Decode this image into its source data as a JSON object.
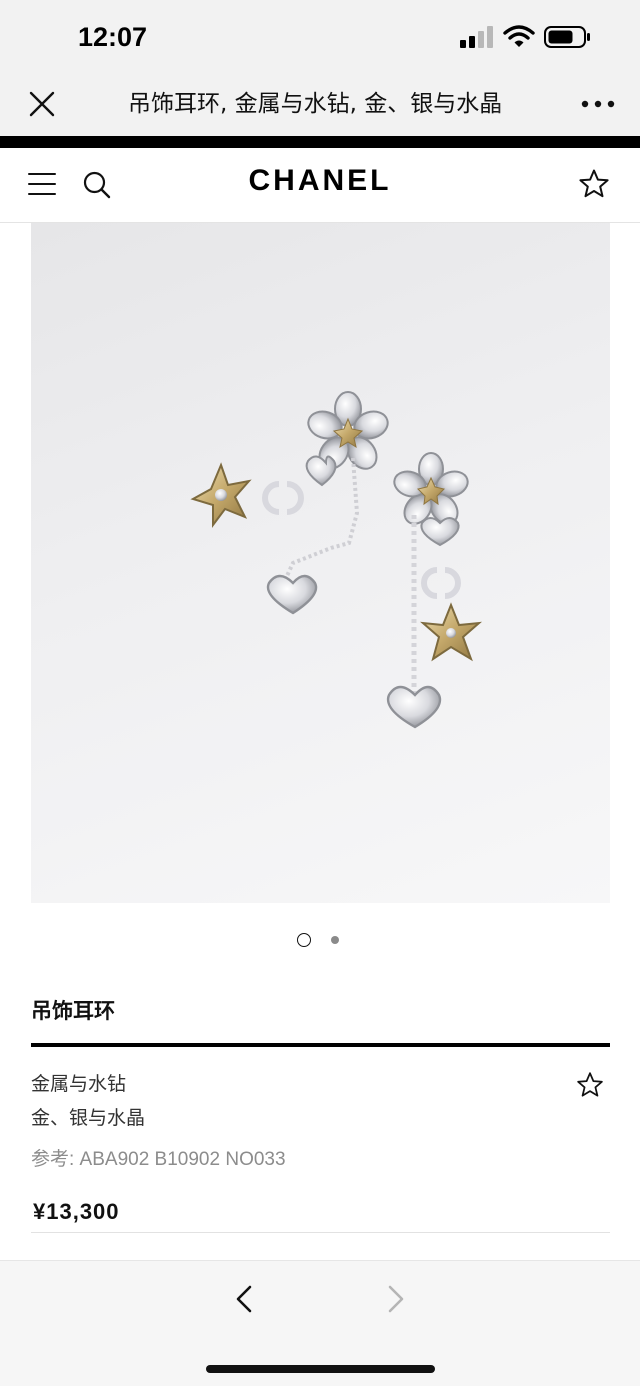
{
  "status_bar": {
    "time": "12:07",
    "icons": [
      "signal-icon",
      "wifi-icon",
      "battery-icon"
    ]
  },
  "webview": {
    "title": "吊饰耳环, 金属与水钻, 金、银与水晶",
    "close_icon": "close-icon",
    "more_icon": "more-icon"
  },
  "header": {
    "brand": "CHANEL",
    "icons": [
      "menu-icon",
      "search-icon",
      "star-icon"
    ]
  },
  "product_image": {
    "pages": 2,
    "current_page": 1
  },
  "product": {
    "name": "吊饰耳环",
    "material": "金属与水钻",
    "color": "金、银与水晶",
    "reference": "参考: ABA902 B10902 NO033",
    "price": "¥13,300"
  },
  "bottom_nav": {
    "back_enabled": true,
    "forward_enabled": false
  },
  "colors": {
    "accent": "#000000",
    "status_bg": "#f2f2f2",
    "muted_text": "#8c8c8c",
    "gold": "#c9b27a",
    "silver": "#c8c8cc"
  }
}
